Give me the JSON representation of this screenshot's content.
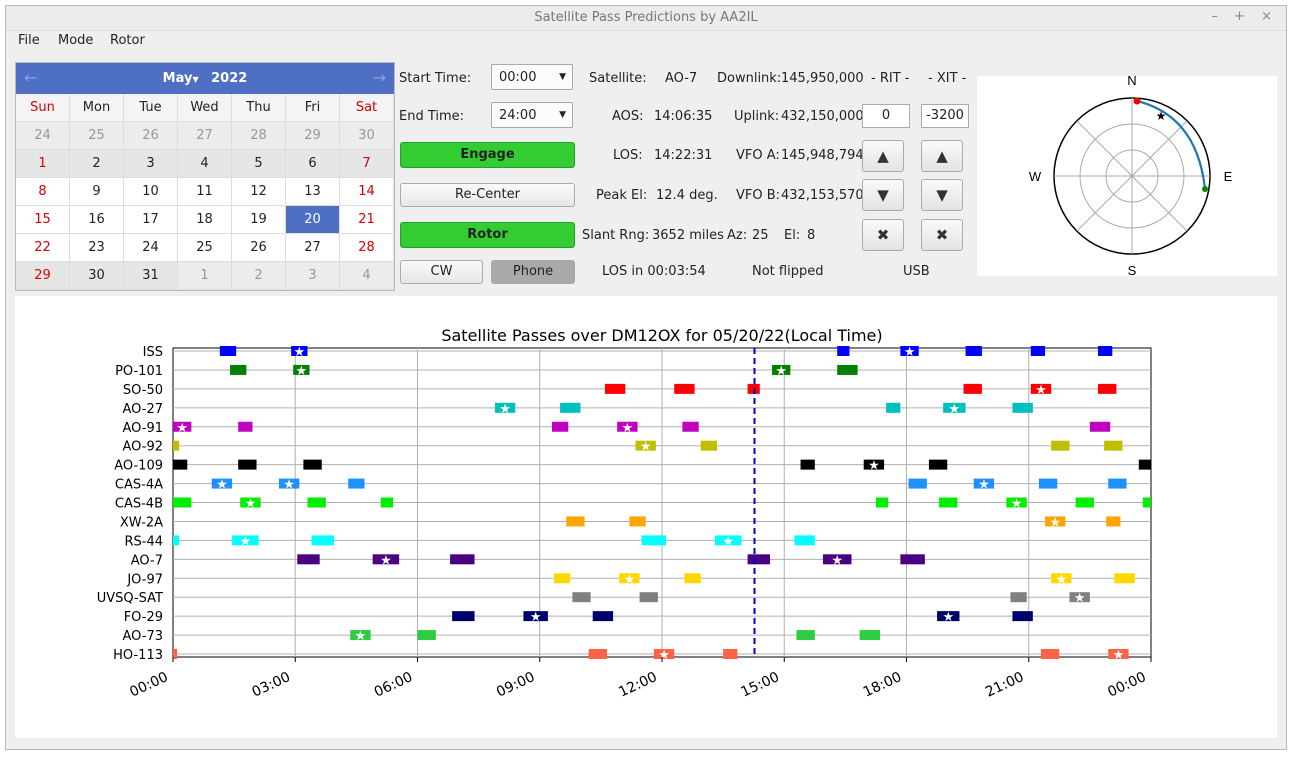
{
  "window": {
    "title": "Satellite Pass Predictions by AA2IL",
    "controls": [
      "–",
      "+",
      "×"
    ]
  },
  "menu": [
    "File",
    "Mode",
    "Rotor"
  ],
  "calendar": {
    "month": "May",
    "year": "2022",
    "weekdays": [
      "Sun",
      "Mon",
      "Tue",
      "Wed",
      "Thu",
      "Fri",
      "Sat"
    ],
    "weeks": [
      [
        "24",
        "25",
        "26",
        "27",
        "28",
        "29",
        "30"
      ],
      [
        "1",
        "2",
        "3",
        "4",
        "5",
        "6",
        "7"
      ],
      [
        "8",
        "9",
        "10",
        "11",
        "12",
        "13",
        "14"
      ],
      [
        "15",
        "16",
        "17",
        "18",
        "19",
        "20",
        "21"
      ],
      [
        "22",
        "23",
        "24",
        "25",
        "26",
        "27",
        "28"
      ],
      [
        "29",
        "30",
        "31",
        "1",
        "2",
        "3",
        "4"
      ]
    ],
    "selected": "20"
  },
  "controls": {
    "start_time_label": "Start Time:",
    "start_time": "00:00",
    "end_time_label": "End Time:",
    "end_time": "24:00",
    "engage": "Engage",
    "recenter": "Re-Center",
    "rotor": "Rotor",
    "cw": "CW",
    "phone": "Phone"
  },
  "info": {
    "satellite_label": "Satellite:",
    "satellite": "AO-7",
    "aos_label": "AOS:",
    "aos": "14:06:35",
    "los_label": "LOS:",
    "los": "14:22:31",
    "peak_label": "Peak El:",
    "peak": "12.4 deg.",
    "slant_label": "Slant Rng:",
    "slant": "3652 miles",
    "az_label": "Az:",
    "az": "25",
    "el_label": "El:",
    "el": "8",
    "los_in": "LOS in 00:03:54",
    "flipped": "Not flipped",
    "mode": "USB",
    "downlink_label": "Downlink:",
    "downlink": "145,950,000",
    "uplink_label": "Uplink:",
    "uplink": "432,150,000",
    "vfoa_label": "VFO A:",
    "vfoa": "145,948,794",
    "vfob_label": "VFO B:",
    "vfob": "432,153,570",
    "rit_label": "- RIT -",
    "rit": "0",
    "xit_label": "- XIT -",
    "xit": "-3200"
  },
  "polar": {
    "n": "N",
    "s": "S",
    "e": "E",
    "w": "W"
  },
  "chart_data": {
    "type": "gantt",
    "title": "Satellite Passes over DM12OX for 05/20/22(Local Time)",
    "x_ticks": [
      "00:00",
      "03:00",
      "06:00",
      "09:00",
      "12:00",
      "15:00",
      "18:00",
      "21:00",
      "00:00"
    ],
    "x_range_hours": [
      0,
      24
    ],
    "now_hour": 14.27,
    "satellites": [
      {
        "name": "ISS",
        "color": "#0000ff",
        "passes": [
          [
            1.15,
            1.55
          ],
          [
            2.9,
            3.3,
            "star"
          ],
          [
            16.3,
            16.6
          ],
          [
            17.85,
            18.3,
            "star"
          ],
          [
            19.45,
            19.85
          ],
          [
            21.05,
            21.4
          ],
          [
            22.7,
            23.05
          ]
        ]
      },
      {
        "name": "PO-101",
        "color": "#008000",
        "passes": [
          [
            1.4,
            1.8
          ],
          [
            2.95,
            3.35,
            "star"
          ],
          [
            14.7,
            15.15,
            "star"
          ],
          [
            16.3,
            16.8
          ]
        ]
      },
      {
        "name": "SO-50",
        "color": "#ff0000",
        "passes": [
          [
            10.6,
            11.1
          ],
          [
            12.3,
            12.8
          ],
          [
            14.1,
            14.4
          ],
          [
            19.4,
            19.85
          ],
          [
            21.05,
            21.55,
            "star"
          ],
          [
            22.7,
            23.15
          ]
        ]
      },
      {
        "name": "AO-27",
        "color": "#00bfbf",
        "passes": [
          [
            7.9,
            8.4,
            "star"
          ],
          [
            9.5,
            10.0
          ],
          [
            17.5,
            17.85
          ],
          [
            18.9,
            19.45,
            "star"
          ],
          [
            20.6,
            21.1
          ]
        ]
      },
      {
        "name": "AO-91",
        "color": "#bf00bf",
        "passes": [
          [
            0.0,
            0.45,
            "star"
          ],
          [
            1.6,
            1.95
          ],
          [
            9.3,
            9.7
          ],
          [
            10.9,
            11.4,
            "star"
          ],
          [
            12.5,
            12.9
          ],
          [
            22.5,
            23.0
          ]
        ]
      },
      {
        "name": "AO-92",
        "color": "#bfbf00",
        "passes": [
          [
            0.0,
            0.15
          ],
          [
            11.35,
            11.85,
            "star"
          ],
          [
            12.95,
            13.35
          ],
          [
            21.55,
            22.0
          ],
          [
            22.85,
            23.3
          ]
        ]
      },
      {
        "name": "AO-109",
        "color": "#000000",
        "passes": [
          [
            0.0,
            0.35
          ],
          [
            1.6,
            2.05
          ],
          [
            3.2,
            3.65
          ],
          [
            15.4,
            15.75
          ],
          [
            16.95,
            17.45,
            "star"
          ],
          [
            18.55,
            19.0
          ],
          [
            23.7,
            24.0
          ]
        ]
      },
      {
        "name": "CAS-4A",
        "color": "#1e90ff",
        "passes": [
          [
            0.95,
            1.45,
            "star"
          ],
          [
            2.6,
            3.1,
            "star"
          ],
          [
            4.3,
            4.7
          ],
          [
            18.05,
            18.5
          ],
          [
            19.65,
            20.15,
            "star"
          ],
          [
            21.25,
            21.7
          ],
          [
            22.95,
            23.4
          ]
        ]
      },
      {
        "name": "CAS-4B",
        "color": "#00ee00",
        "passes": [
          [
            0.0,
            0.45
          ],
          [
            1.65,
            2.15,
            "star"
          ],
          [
            3.3,
            3.75
          ],
          [
            5.1,
            5.4
          ],
          [
            17.25,
            17.55
          ],
          [
            18.8,
            19.25
          ],
          [
            20.45,
            20.95,
            "star"
          ],
          [
            22.15,
            22.6
          ],
          [
            23.8,
            24.0
          ]
        ]
      },
      {
        "name": "XW-2A",
        "color": "#ffa500",
        "passes": [
          [
            9.65,
            10.1
          ],
          [
            11.2,
            11.6
          ],
          [
            21.4,
            21.9,
            "star"
          ],
          [
            22.9,
            23.25
          ]
        ]
      },
      {
        "name": "RS-44",
        "color": "#00ffff",
        "passes": [
          [
            0.0,
            0.15
          ],
          [
            1.45,
            2.1,
            "star"
          ],
          [
            3.4,
            3.95
          ],
          [
            11.5,
            12.1
          ],
          [
            13.3,
            13.95,
            "star"
          ],
          [
            15.25,
            15.75
          ]
        ]
      },
      {
        "name": "AO-7",
        "color": "#4b0082",
        "passes": [
          [
            3.05,
            3.6
          ],
          [
            4.9,
            5.55,
            "star"
          ],
          [
            6.8,
            7.4
          ],
          [
            14.1,
            14.65
          ],
          [
            15.95,
            16.65,
            "star"
          ],
          [
            17.85,
            18.45
          ]
        ]
      },
      {
        "name": "JO-97",
        "color": "#ffd700",
        "passes": [
          [
            9.35,
            9.75
          ],
          [
            10.95,
            11.45,
            "star"
          ],
          [
            12.55,
            12.95
          ],
          [
            21.55,
            22.05,
            "star"
          ],
          [
            23.1,
            23.6
          ]
        ]
      },
      {
        "name": "UVSQ-SAT",
        "color": "#808080",
        "passes": [
          [
            9.8,
            10.25
          ],
          [
            11.45,
            11.9
          ],
          [
            20.55,
            20.95
          ],
          [
            22.0,
            22.5,
            "star"
          ]
        ]
      },
      {
        "name": "FO-29",
        "color": "#00006b",
        "passes": [
          [
            6.85,
            7.4
          ],
          [
            8.6,
            9.2,
            "star"
          ],
          [
            10.3,
            10.8
          ],
          [
            18.75,
            19.3,
            "star"
          ],
          [
            20.6,
            21.1
          ]
        ]
      },
      {
        "name": "AO-73",
        "color": "#2ecc40",
        "passes": [
          [
            4.35,
            4.85,
            "star"
          ],
          [
            6.0,
            6.45
          ],
          [
            15.3,
            15.75
          ],
          [
            16.85,
            17.35
          ]
        ]
      },
      {
        "name": "HO-113",
        "color": "#ff6347",
        "passes": [
          [
            0.0,
            0.1
          ],
          [
            10.2,
            10.65
          ],
          [
            11.8,
            12.3,
            "star"
          ],
          [
            13.5,
            13.85
          ],
          [
            21.3,
            21.75
          ],
          [
            22.95,
            23.45,
            "star"
          ]
        ]
      }
    ]
  }
}
